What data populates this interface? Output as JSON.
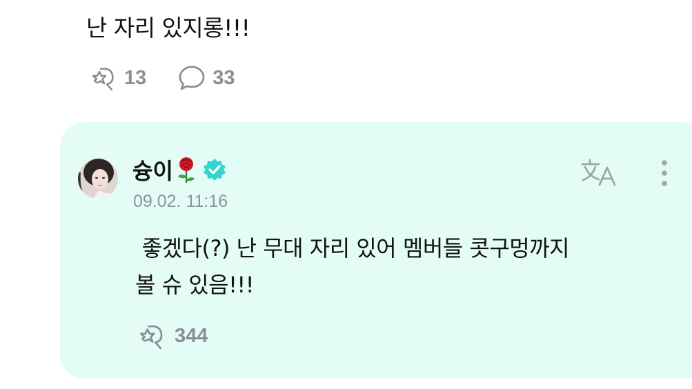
{
  "post": {
    "text": "난 자리 있지롱!!!",
    "like_icon": "sparkle-heart-icon",
    "like_count": "13",
    "comment_icon": "speech-bubble-icon",
    "comment_count": "33"
  },
  "reply": {
    "author_name": "슝이",
    "author_emoji": "rose-icon",
    "verified_icon": "verified-badge-icon",
    "timestamp": "09.02. 11:16",
    "text": " 좋겠다(?) 난 무대 자리 있어 멤버들 콧구멍까지\n볼 슈 있음!!!",
    "translate_icon": "translate-icon",
    "more_icon": "more-vertical-icon",
    "like_icon": "sparkle-heart-icon",
    "like_count": "344"
  },
  "colors": {
    "card_background": "#e4fcf6",
    "icon_gray": "#8a8f94",
    "verified_teal": "#35d5cf",
    "text": "#111111"
  }
}
